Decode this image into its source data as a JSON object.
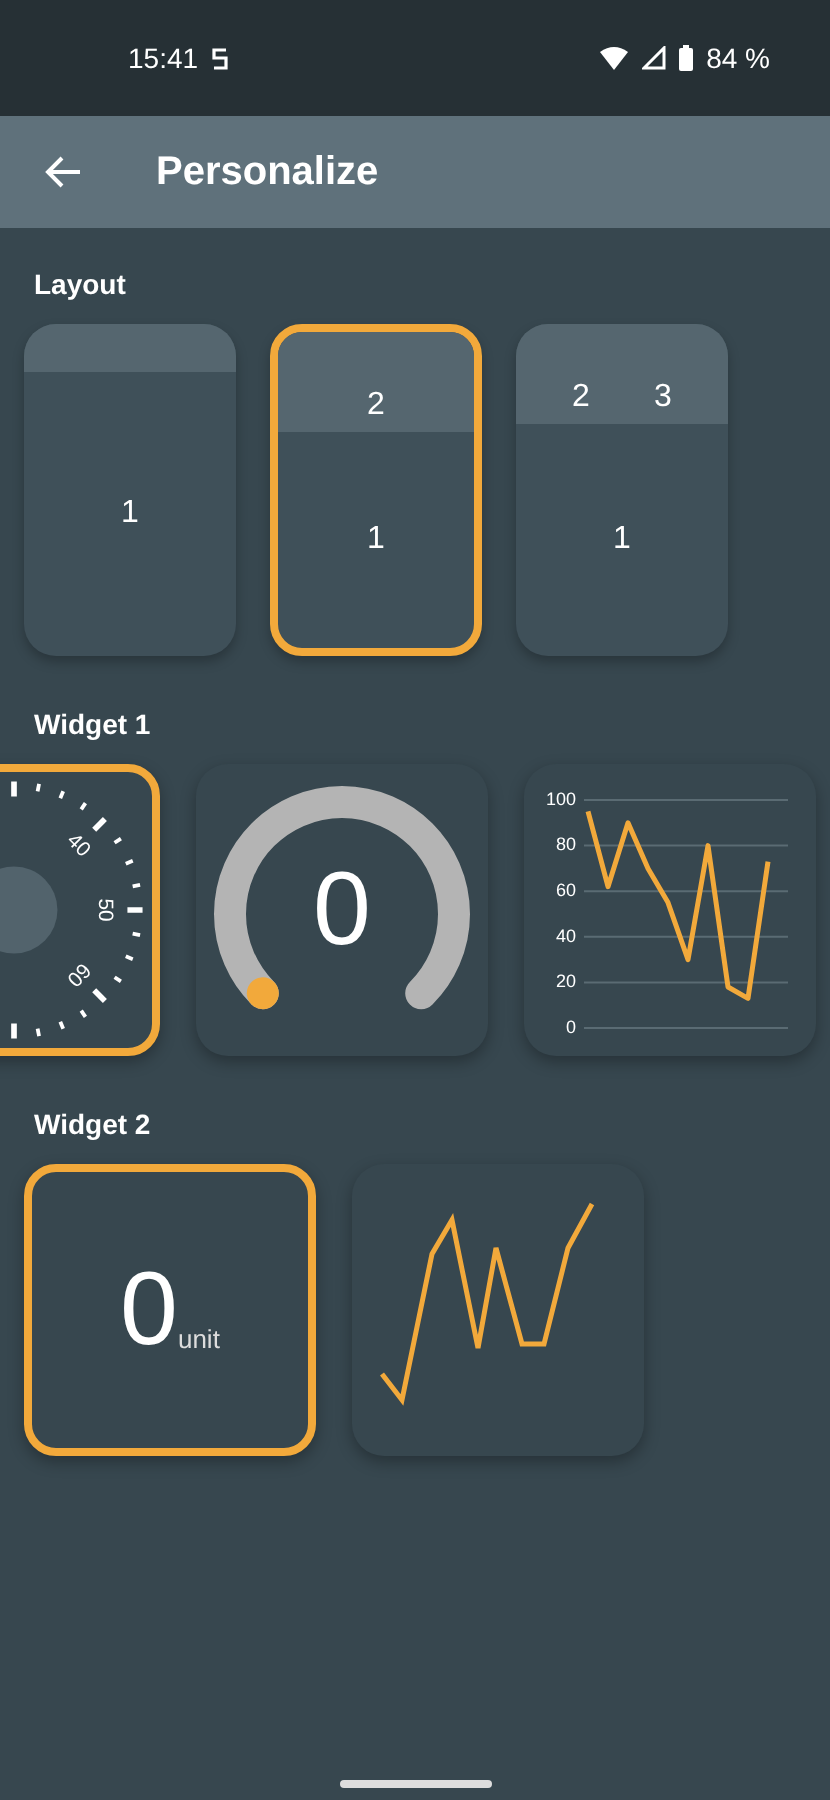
{
  "status_bar": {
    "time": "15:41",
    "battery": "84 %"
  },
  "app_bar": {
    "title": "Personalize"
  },
  "sections": [
    {
      "kind": "layouts",
      "title": "Layout",
      "items": [
        {
          "body": "1",
          "selected": false
        },
        {
          "header": [
            "2"
          ],
          "body": "1",
          "selected": true
        },
        {
          "header": [
            "2",
            "3"
          ],
          "body": "1",
          "selected": false
        }
      ]
    },
    {
      "kind": "widgets",
      "title": "Widget 1",
      "items": [
        {
          "kind": "dial",
          "selected": true,
          "labels": [
            "40",
            "50",
            "60"
          ]
        },
        {
          "kind": "gauge",
          "selected": false,
          "value": "0"
        },
        {
          "kind": "chart",
          "selected": false,
          "chart_data": {
            "type": "line",
            "values": [
              95,
              62,
              90,
              70,
              55,
              30,
              80,
              18,
              13,
              73
            ],
            "ylim": [
              0,
              100
            ],
            "yticks": [
              0,
              20,
              40,
              60,
              80,
              100
            ],
            "grid": true
          }
        }
      ]
    },
    {
      "kind": "widgets",
      "title": "Widget 2",
      "items": [
        {
          "kind": "number",
          "selected": true,
          "value": "0",
          "unit": "unit"
        },
        {
          "kind": "sparkline",
          "selected": false
        }
      ]
    }
  ]
}
